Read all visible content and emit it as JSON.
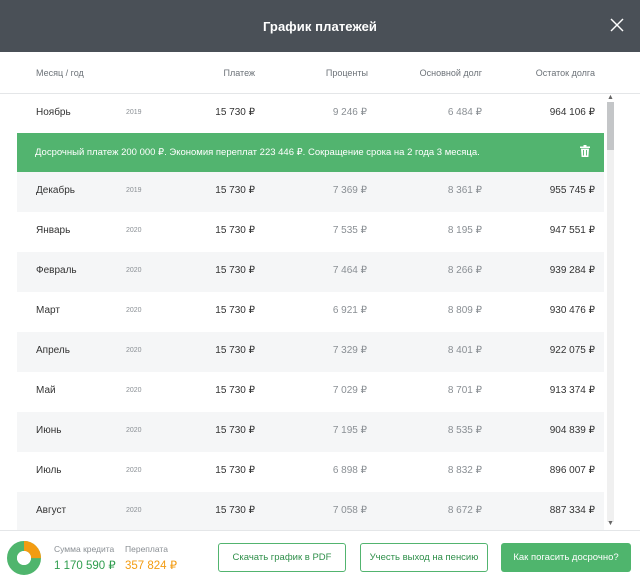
{
  "header": {
    "title": "График платежей"
  },
  "columns": {
    "month_year": "Месяц / год",
    "payment": "Платеж",
    "interest": "Проценты",
    "principal": "Основной долг",
    "balance": "Остаток долга"
  },
  "rows": [
    {
      "month": "Ноябрь",
      "year": "2019",
      "payment": "15 730 ₽",
      "interest": "9 246 ₽",
      "principal": "6 484 ₽",
      "balance": "964 106 ₽"
    },
    {
      "month": "Декабрь",
      "year": "2019",
      "payment": "15 730 ₽",
      "interest": "7 369 ₽",
      "principal": "8 361 ₽",
      "balance": "955 745 ₽"
    },
    {
      "month": "Январь",
      "year": "2020",
      "payment": "15 730 ₽",
      "interest": "7 535 ₽",
      "principal": "8 195 ₽",
      "balance": "947 551 ₽"
    },
    {
      "month": "Февраль",
      "year": "2020",
      "payment": "15 730 ₽",
      "interest": "7 464 ₽",
      "principal": "8 266 ₽",
      "balance": "939 284 ₽"
    },
    {
      "month": "Март",
      "year": "2020",
      "payment": "15 730 ₽",
      "interest": "6 921 ₽",
      "principal": "8 809 ₽",
      "balance": "930 476 ₽"
    },
    {
      "month": "Апрель",
      "year": "2020",
      "payment": "15 730 ₽",
      "interest": "7 329 ₽",
      "principal": "8 401 ₽",
      "balance": "922 075 ₽"
    },
    {
      "month": "Май",
      "year": "2020",
      "payment": "15 730 ₽",
      "interest": "7 029 ₽",
      "principal": "8 701 ₽",
      "balance": "913 374 ₽"
    },
    {
      "month": "Июнь",
      "year": "2020",
      "payment": "15 730 ₽",
      "interest": "7 195 ₽",
      "principal": "8 535 ₽",
      "balance": "904 839 ₽"
    },
    {
      "month": "Июль",
      "year": "2020",
      "payment": "15 730 ₽",
      "interest": "6 898 ₽",
      "principal": "8 832 ₽",
      "balance": "896 007 ₽"
    },
    {
      "month": "Август",
      "year": "2020",
      "payment": "15 730 ₽",
      "interest": "7 058 ₽",
      "principal": "8 672 ₽",
      "balance": "887 334 ₽"
    }
  ],
  "banner": {
    "text": "Досрочный платеж 200 000 ₽. Экономия переплат 223 446 ₽. Сокращение срока на 2 года 3 месяца."
  },
  "footer": {
    "loan_label": "Сумма кредита",
    "loan_value": "1 170 590 ₽",
    "overpay_label": "Переплата",
    "overpay_value": "357 824 ₽",
    "pdf_button": "Скачать график в PDF",
    "pension_button": "Учесть выход на пенсию",
    "early_button": "Как погасить досрочно?"
  },
  "colors": {
    "accent": "#52b46f",
    "overpay": "#f39c12",
    "header": "#4a5057"
  },
  "icons": {
    "close": "close-icon",
    "trash": "trash-icon",
    "pie": "pie-chart-icon"
  }
}
